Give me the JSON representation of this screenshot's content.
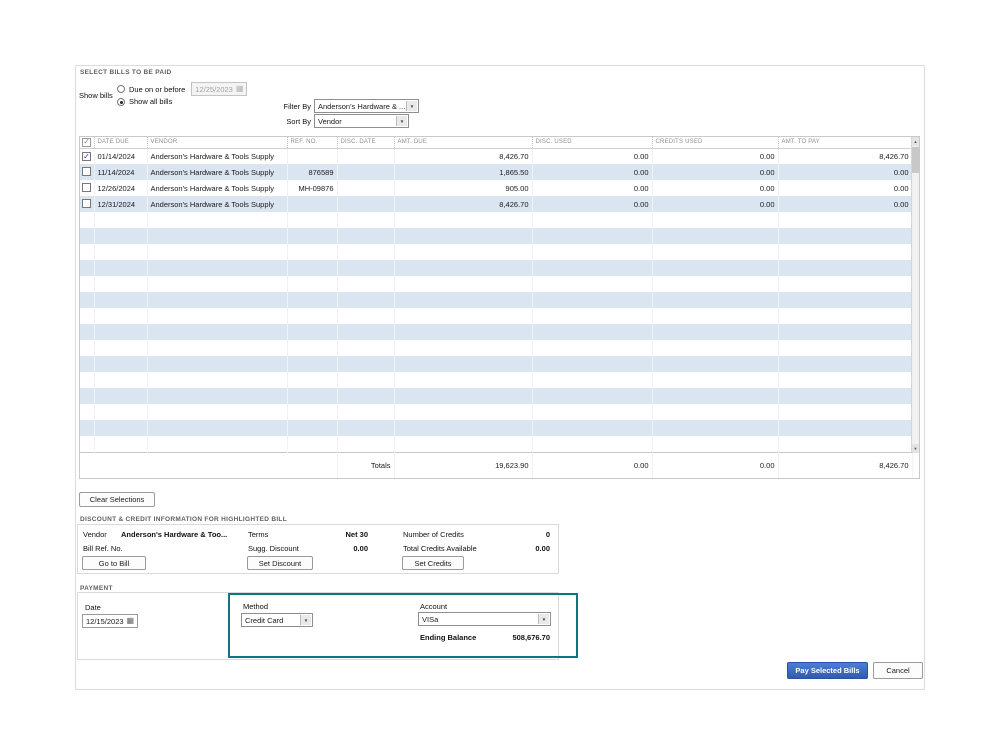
{
  "icons": {
    "calendar": "▦",
    "dropdown_arrow": "▼",
    "check": "✓",
    "scroll_up": "▲",
    "scroll_down": "▼"
  },
  "select_bills": {
    "title": "SELECT BILLS TO BE PAID",
    "show_bills_label": "Show bills",
    "due_label": "Due on or before",
    "due_date": "12/25/2023",
    "due_selected": false,
    "show_all_label": "Show all bills",
    "show_all_selected": true,
    "filter_by_label": "Filter By",
    "filter_value": "Anderson's Hardware & ...",
    "sort_by_label": "Sort By",
    "sort_value": "Vendor"
  },
  "table": {
    "headers": [
      "DATE DUE",
      "VENDOR",
      "REF. NO.",
      "DISC. DATE",
      "AMT. DUE",
      "DISC. USED",
      "CREDITS USED",
      "AMT. TO PAY"
    ],
    "rows": [
      {
        "checked": true,
        "date_due": "01/14/2024",
        "vendor": "Anderson's Hardware & Tools Supply",
        "ref_no": "",
        "disc_date": "",
        "amt_due": "8,426.70",
        "disc_used": "0.00",
        "credits_used": "0.00",
        "amt_to_pay": "8,426.70"
      },
      {
        "checked": false,
        "date_due": "11/14/2024",
        "vendor": "Anderson's Hardware & Tools Supply",
        "ref_no": "876589",
        "disc_date": "",
        "amt_due": "1,865.50",
        "disc_used": "0.00",
        "credits_used": "0.00",
        "amt_to_pay": "0.00"
      },
      {
        "checked": false,
        "date_due": "12/26/2024",
        "vendor": "Anderson's Hardware & Tools Supply",
        "ref_no": "MH-09876",
        "disc_date": "",
        "amt_due": "905.00",
        "disc_used": "0.00",
        "credits_used": "0.00",
        "amt_to_pay": "0.00"
      },
      {
        "checked": false,
        "date_due": "12/31/2024",
        "vendor": "Anderson's Hardware & Tools Supply",
        "ref_no": "",
        "disc_date": "",
        "amt_due": "8,426.70",
        "disc_used": "0.00",
        "credits_used": "0.00",
        "amt_to_pay": "0.00"
      }
    ],
    "totals": {
      "label": "Totals",
      "amt_due": "19,623.90",
      "disc_used": "0.00",
      "credits_used": "0.00",
      "amt_to_pay": "8,426.70"
    }
  },
  "buttons": {
    "clear_selections": "Clear Selections"
  },
  "discount": {
    "title": "DISCOUNT & CREDIT INFORMATION FOR HIGHLIGHTED BILL",
    "vendor_label": "Vendor",
    "vendor_value": "Anderson's Hardware & Too...",
    "bill_ref_label": "Bill Ref. No.",
    "go_to_bill": "Go to Bill",
    "terms_label": "Terms",
    "terms_value": "Net 30",
    "sugg_discount_label": "Sugg. Discount",
    "sugg_discount_value": "0.00",
    "set_discount": "Set Discount",
    "credits_count_label": "Number of Credits",
    "credits_count_value": "0",
    "credits_avail_label": "Total Credits Available",
    "credits_avail_value": "0.00",
    "set_credits": "Set Credits"
  },
  "payment": {
    "title": "PAYMENT",
    "date_label": "Date",
    "date_value": "12/15/2023",
    "method_label": "Method",
    "method_value": "Credit Card",
    "account_label": "Account",
    "account_value": "VISa",
    "ending_balance_label": "Ending Balance",
    "ending_balance_value": "508,676.70"
  },
  "footer": {
    "pay_selected_bills": "Pay Selected Bills",
    "cancel": "Cancel"
  }
}
